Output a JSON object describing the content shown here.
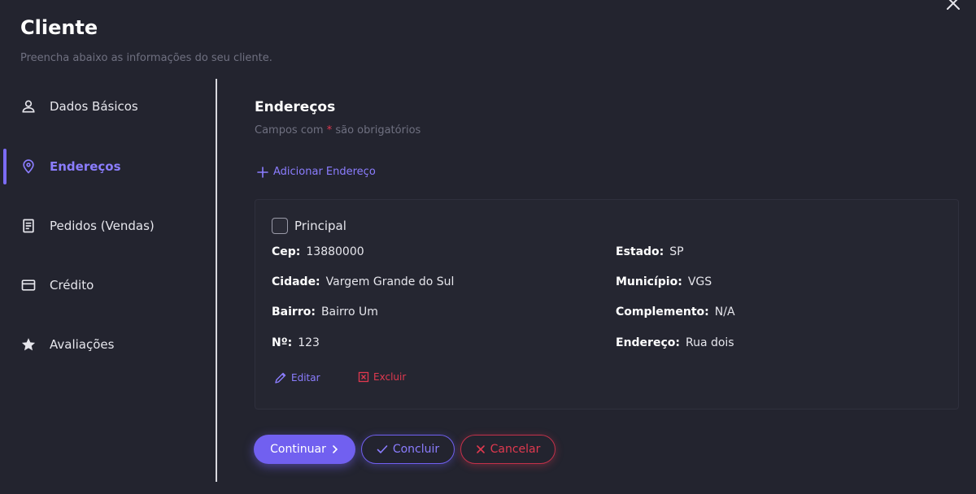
{
  "header": {
    "title": "Cliente",
    "subtitle": "Preencha abaixo as informações do seu cliente."
  },
  "sidebar": {
    "items": [
      {
        "label": "Dados Básicos",
        "icon": "user-icon",
        "active": false
      },
      {
        "label": "Endereços",
        "icon": "location-pin-icon",
        "active": true
      },
      {
        "label": "Pedidos (Vendas)",
        "icon": "receipt-icon",
        "active": false
      },
      {
        "label": "Crédito",
        "icon": "credit-card-icon",
        "active": false
      },
      {
        "label": "Avaliações",
        "icon": "star-icon",
        "active": false
      }
    ]
  },
  "section": {
    "title": "Endereços",
    "note_prefix": "Campos com ",
    "note_required": "*",
    "note_suffix": " são obrigatórios",
    "add_label": "Adicionar Endereço"
  },
  "address": {
    "principal_label": "Principal",
    "principal_checked": false,
    "fields": {
      "cep": {
        "label": "Cep:",
        "value": "13880000"
      },
      "estado": {
        "label": "Estado:",
        "value": "SP"
      },
      "cidade": {
        "label": "Cidade:",
        "value": "Vargem Grande do Sul"
      },
      "municipio": {
        "label": "Município:",
        "value": "VGS"
      },
      "bairro": {
        "label": "Bairro:",
        "value": "Bairro Um"
      },
      "complemento": {
        "label": "Complemento:",
        "value": "N/A"
      },
      "numero": {
        "label": "Nº:",
        "value": "123"
      },
      "endereco": {
        "label": "Endereço:",
        "value": "Rua dois"
      }
    },
    "edit_label": "Editar",
    "delete_label": "Excluir"
  },
  "footer": {
    "continue_label": "Continuar",
    "finish_label": "Concluir",
    "cancel_label": "Cancelar"
  },
  "colors": {
    "background": "#23242f",
    "accent": "#7160f0",
    "accent_text": "#8b7dff",
    "danger": "#e0394f",
    "muted_text": "#6f7080"
  }
}
